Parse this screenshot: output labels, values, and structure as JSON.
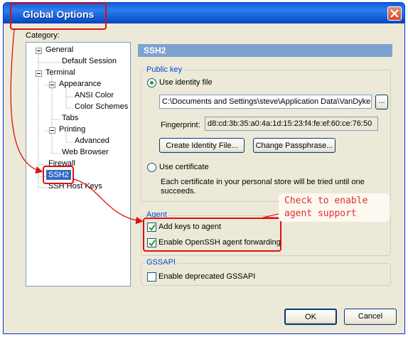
{
  "window": {
    "title": "Global Options"
  },
  "category": {
    "label": "Category:",
    "tree": {
      "general": "General",
      "default_session": "Default Session",
      "terminal": "Terminal",
      "appearance": "Appearance",
      "ansi_color": "ANSI Color",
      "color_schemes": "Color Schemes",
      "tabs": "Tabs",
      "printing": "Printing",
      "advanced": "Advanced",
      "web_browser": "Web Browser",
      "firewall": "Firewall",
      "ssh2": "SSH2",
      "ssh_host_keys": "SSH Host Keys"
    }
  },
  "panel": {
    "header": "SSH2",
    "public_key": {
      "title": "Public key",
      "use_identity_file": "Use identity file",
      "identity_path": "C:\\Documents and Settings\\steve\\Application Data\\VanDyke",
      "browse_label": "...",
      "fingerprint_label": "Fingerprint:",
      "fingerprint_value": "d8:cd:3b:35:a0:4a:1d:15:23:f4:fe:ef:60:ce:76:50",
      "create_button": "Create Identity File...",
      "change_button": "Change Passphrase...",
      "use_certificate": "Use certificate",
      "certificate_note_1": "Each certificate in your personal store will be tried until one",
      "certificate_note_2": "succeeds."
    },
    "agent": {
      "title": "Agent",
      "add_keys": "Add keys to agent",
      "enable_forwarding": "Enable OpenSSH agent forwarding"
    },
    "gssapi": {
      "title": "GSSAPI",
      "enable_deprecated": "Enable deprecated GSSAPI"
    }
  },
  "buttons": {
    "ok": "OK",
    "cancel": "Cancel"
  },
  "annotation": {
    "line1": "Check to enable",
    "line2": "agent support",
    "color": "#e01010"
  },
  "state": {
    "use_identity_file_selected": true,
    "use_certificate_selected": false,
    "add_keys_checked": true,
    "enable_forwarding_checked": true,
    "deprecated_gssapi_checked": false
  }
}
